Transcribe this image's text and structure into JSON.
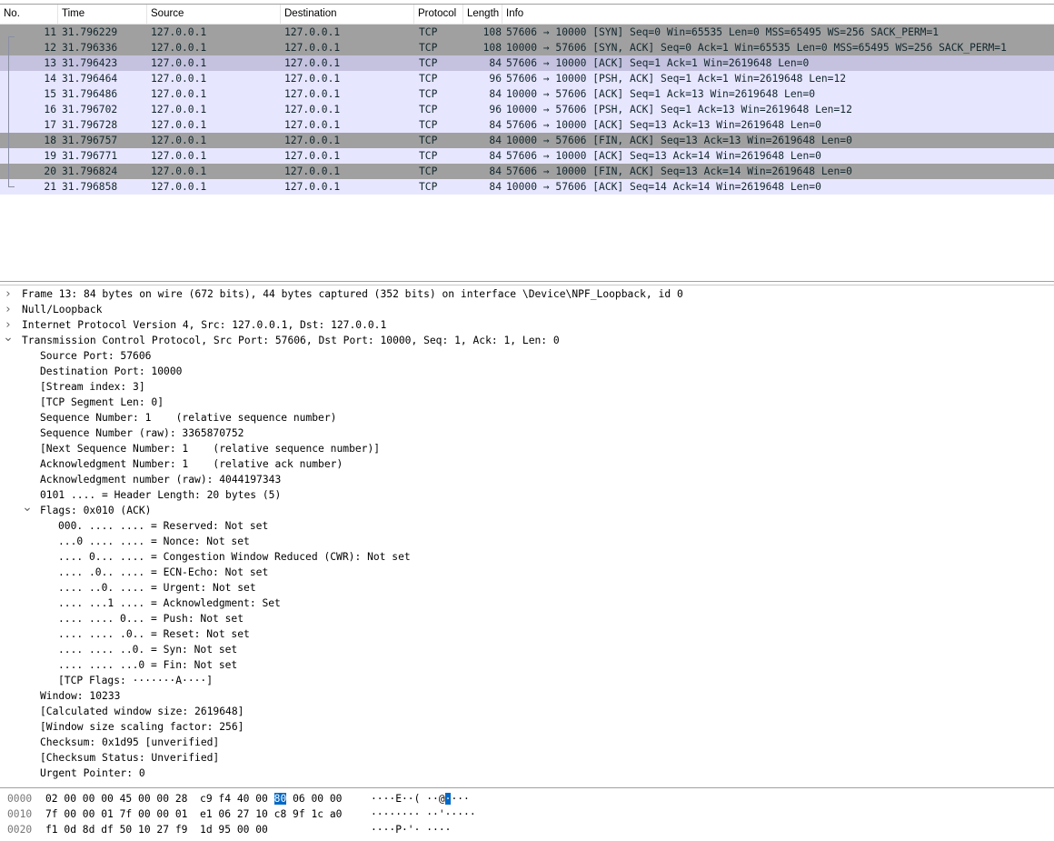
{
  "packet_list": {
    "columns": [
      "No.",
      "Time",
      "Source",
      "Destination",
      "Protocol",
      "Length",
      "Info"
    ],
    "rows": [
      {
        "no": "11",
        "time": "31.796229",
        "src": "127.0.0.1",
        "dst": "127.0.0.1",
        "proto": "TCP",
        "len": "108",
        "info": "57606 → 10000 [SYN] Seq=0 Win=65535 Len=0 MSS=65495 WS=256 SACK_PERM=1",
        "style": "gray"
      },
      {
        "no": "12",
        "time": "31.796336",
        "src": "127.0.0.1",
        "dst": "127.0.0.1",
        "proto": "TCP",
        "len": "108",
        "info": "10000 → 57606 [SYN, ACK] Seq=0 Ack=1 Win=65535 Len=0 MSS=65495 WS=256 SACK_PERM=1",
        "style": "gray"
      },
      {
        "no": "13",
        "time": "31.796423",
        "src": "127.0.0.1",
        "dst": "127.0.0.1",
        "proto": "TCP",
        "len": "84",
        "info": "57606 → 10000 [ACK] Seq=1 Ack=1 Win=2619648 Len=0",
        "style": "sel"
      },
      {
        "no": "14",
        "time": "31.796464",
        "src": "127.0.0.1",
        "dst": "127.0.0.1",
        "proto": "TCP",
        "len": "96",
        "info": "57606 → 10000 [PSH, ACK] Seq=1 Ack=1 Win=2619648 Len=12",
        "style": "light"
      },
      {
        "no": "15",
        "time": "31.796486",
        "src": "127.0.0.1",
        "dst": "127.0.0.1",
        "proto": "TCP",
        "len": "84",
        "info": "10000 → 57606 [ACK] Seq=1 Ack=13 Win=2619648 Len=0",
        "style": "light"
      },
      {
        "no": "16",
        "time": "31.796702",
        "src": "127.0.0.1",
        "dst": "127.0.0.1",
        "proto": "TCP",
        "len": "96",
        "info": "10000 → 57606 [PSH, ACK] Seq=1 Ack=13 Win=2619648 Len=12",
        "style": "light"
      },
      {
        "no": "17",
        "time": "31.796728",
        "src": "127.0.0.1",
        "dst": "127.0.0.1",
        "proto": "TCP",
        "len": "84",
        "info": "57606 → 10000 [ACK] Seq=13 Ack=13 Win=2619648 Len=0",
        "style": "light"
      },
      {
        "no": "18",
        "time": "31.796757",
        "src": "127.0.0.1",
        "dst": "127.0.0.1",
        "proto": "TCP",
        "len": "84",
        "info": "10000 → 57606 [FIN, ACK] Seq=13 Ack=13 Win=2619648 Len=0",
        "style": "gray"
      },
      {
        "no": "19",
        "time": "31.796771",
        "src": "127.0.0.1",
        "dst": "127.0.0.1",
        "proto": "TCP",
        "len": "84",
        "info": "57606 → 10000 [ACK] Seq=13 Ack=14 Win=2619648 Len=0",
        "style": "light"
      },
      {
        "no": "20",
        "time": "31.796824",
        "src": "127.0.0.1",
        "dst": "127.0.0.1",
        "proto": "TCP",
        "len": "84",
        "info": "57606 → 10000 [FIN, ACK] Seq=13 Ack=14 Win=2619648 Len=0",
        "style": "gray"
      },
      {
        "no": "21",
        "time": "31.796858",
        "src": "127.0.0.1",
        "dst": "127.0.0.1",
        "proto": "TCP",
        "len": "84",
        "info": "10000 → 57606 [ACK] Seq=14 Ack=14 Win=2619648 Len=0",
        "style": "light"
      }
    ]
  },
  "details": {
    "lines": [
      {
        "text": "Frame 13: 84 bytes on wire (672 bits), 44 bytes captured (352 bits) on interface \\Device\\NPF_Loopback, id 0",
        "level": 0,
        "expander": "collapsed"
      },
      {
        "text": "Null/Loopback",
        "level": 0,
        "expander": "collapsed"
      },
      {
        "text": "Internet Protocol Version 4, Src: 127.0.0.1, Dst: 127.0.0.1",
        "level": 0,
        "expander": "collapsed"
      },
      {
        "text": "Transmission Control Protocol, Src Port: 57606, Dst Port: 10000, Seq: 1, Ack: 1, Len: 0",
        "level": 0,
        "expander": "expanded"
      },
      {
        "text": "Source Port: 57606",
        "level": 1,
        "expander": ""
      },
      {
        "text": "Destination Port: 10000",
        "level": 1,
        "expander": ""
      },
      {
        "text": "[Stream index: 3]",
        "level": 1,
        "expander": ""
      },
      {
        "text": "[TCP Segment Len: 0]",
        "level": 1,
        "expander": ""
      },
      {
        "text": "Sequence Number: 1    (relative sequence number)",
        "level": 1,
        "expander": ""
      },
      {
        "text": "Sequence Number (raw): 3365870752",
        "level": 1,
        "expander": ""
      },
      {
        "text": "[Next Sequence Number: 1    (relative sequence number)]",
        "level": 1,
        "expander": ""
      },
      {
        "text": "Acknowledgment Number: 1    (relative ack number)",
        "level": 1,
        "expander": ""
      },
      {
        "text": "Acknowledgment number (raw): 4044197343",
        "level": 1,
        "expander": ""
      },
      {
        "text": "0101 .... = Header Length: 20 bytes (5)",
        "level": 1,
        "expander": ""
      },
      {
        "text": "Flags: 0x010 (ACK)",
        "level": 1,
        "expander": "expanded"
      },
      {
        "text": "000. .... .... = Reserved: Not set",
        "level": 2,
        "expander": ""
      },
      {
        "text": "...0 .... .... = Nonce: Not set",
        "level": 2,
        "expander": ""
      },
      {
        "text": ".... 0... .... = Congestion Window Reduced (CWR): Not set",
        "level": 2,
        "expander": ""
      },
      {
        "text": ".... .0.. .... = ECN-Echo: Not set",
        "level": 2,
        "expander": ""
      },
      {
        "text": ".... ..0. .... = Urgent: Not set",
        "level": 2,
        "expander": ""
      },
      {
        "text": ".... ...1 .... = Acknowledgment: Set",
        "level": 2,
        "expander": ""
      },
      {
        "text": ".... .... 0... = Push: Not set",
        "level": 2,
        "expander": ""
      },
      {
        "text": ".... .... .0.. = Reset: Not set",
        "level": 2,
        "expander": ""
      },
      {
        "text": ".... .... ..0. = Syn: Not set",
        "level": 2,
        "expander": ""
      },
      {
        "text": ".... .... ...0 = Fin: Not set",
        "level": 2,
        "expander": ""
      },
      {
        "text": "[TCP Flags: ·······A····]",
        "level": 2,
        "expander": ""
      },
      {
        "text": "Window: 10233",
        "level": 1,
        "expander": ""
      },
      {
        "text": "[Calculated window size: 2619648]",
        "level": 1,
        "expander": ""
      },
      {
        "text": "[Window size scaling factor: 256]",
        "level": 1,
        "expander": ""
      },
      {
        "text": "Checksum: 0x1d95 [unverified]",
        "level": 1,
        "expander": ""
      },
      {
        "text": "[Checksum Status: Unverified]",
        "level": 1,
        "expander": ""
      },
      {
        "text": "Urgent Pointer: 0",
        "level": 1,
        "expander": ""
      }
    ]
  },
  "bytes": {
    "lines": [
      {
        "offset": "0000",
        "hex_pre": "02 00 00 00 45 00 00 28  c9 f4 40 00 ",
        "hex_hl": "80",
        "hex_post": " 06 00 00",
        "ascii_pre": "····E··( ··@",
        "ascii_hl": "·",
        "ascii_post": "···"
      },
      {
        "offset": "0010",
        "hex_pre": "7f 00 00 01 7f 00 00 01  e1 06 27 10 c8 9f 1c a0",
        "hex_hl": "",
        "hex_post": "",
        "ascii_pre": "········ ··'·····",
        "ascii_hl": "",
        "ascii_post": ""
      },
      {
        "offset": "0020",
        "hex_pre": "f1 0d 8d df 50 10 27 f9  1d 95 00 00",
        "hex_hl": "",
        "hex_post": "",
        "ascii_pre": "····P·'· ····",
        "ascii_hl": "",
        "ascii_post": ""
      }
    ]
  },
  "colors": {
    "row_gray": "#a0a0a0",
    "row_light": "#e7e6ff",
    "row_selected": "#c4c2de",
    "byte_highlight": "#0068c8"
  },
  "icons": {
    "collapsed": "chevron-right-icon",
    "expanded": "chevron-down-icon"
  }
}
